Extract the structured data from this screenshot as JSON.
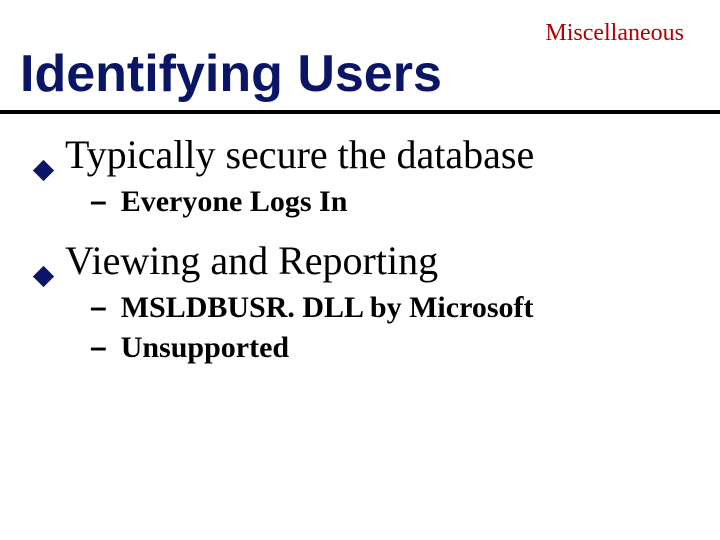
{
  "topic": "Miscellaneous",
  "title": "Identifying Users",
  "bullets": [
    {
      "text": "Typically secure the database",
      "subs": [
        "Everyone Logs In"
      ]
    },
    {
      "text": " Viewing and Reporting",
      "subs": [
        "MSLDBUSR. DLL by Microsoft",
        "Unsupported"
      ]
    }
  ]
}
